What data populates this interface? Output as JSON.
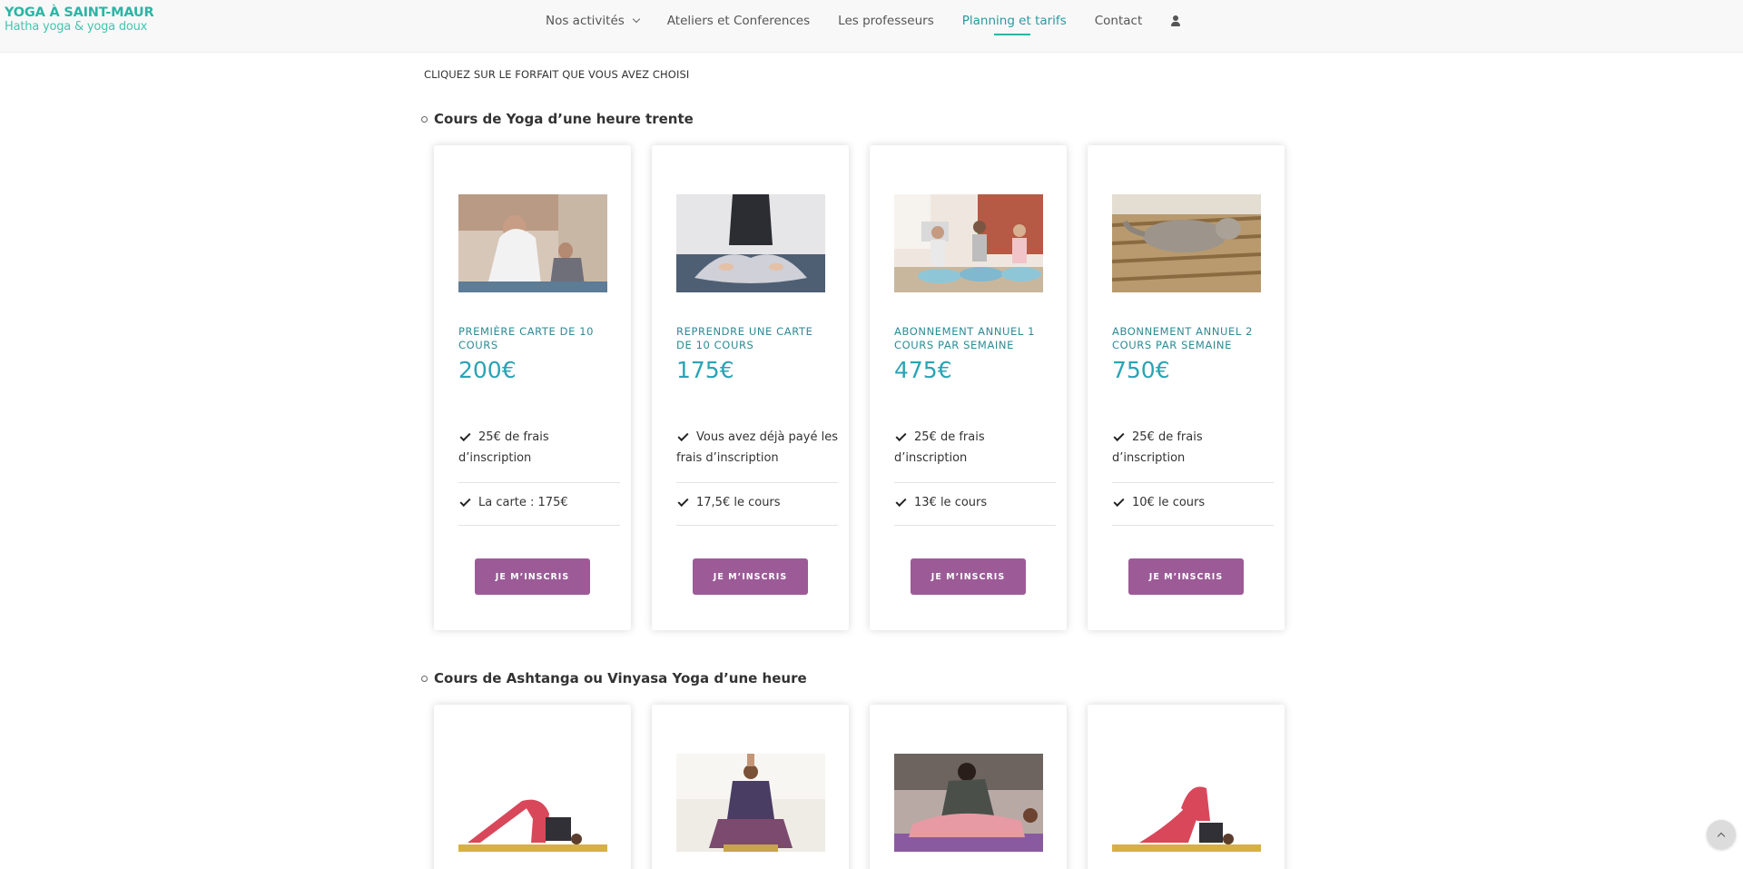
{
  "brand": {
    "title": "YOGA À SAINT-MAUR",
    "subtitle": "Hatha yoga & yoga doux"
  },
  "nav": {
    "items": [
      "Nos activités",
      "Ateliers et Conferences",
      "Les professeurs",
      "Planning et tarifs",
      "Contact"
    ],
    "active": "Planning et tarifs"
  },
  "intro": "CLIQUEZ SUR LE FORFAIT QUE VOUS AVEZ CHOISI",
  "sections": [
    {
      "title": "Cours de Yoga d’une heure trente",
      "cards": [
        {
          "title": "PREMIÈRE CARTE DE 10 COURS",
          "price": "200€",
          "features": [
            "25€ de frais d’inscription",
            "La carte : 175€"
          ],
          "button": "JE M’INSCRIS",
          "image": "yoga-class-photo"
        },
        {
          "title": "REPRENDRE UNE CARTE DE 10 COURS",
          "price": "175€",
          "features": [
            "Vous avez déjà payé les frais d’inscription",
            "17,5€ le cours"
          ],
          "button": "JE M’INSCRIS",
          "image": "lotus-pose-photo"
        },
        {
          "title": "ABONNEMENT ANNUEL 1 COURS PAR SEMAINE",
          "price": "475€",
          "features": [
            "25€ de frais d’inscription",
            "13€ le cours"
          ],
          "button": "JE M’INSCRIS",
          "image": "group-meditation-photo"
        },
        {
          "title": "ABONNEMENT ANNUEL 2 COURS PAR SEMAINE",
          "price": "750€",
          "features": [
            "25€ de frais d’inscription",
            "10€ le cours"
          ],
          "button": "JE M’INSCRIS",
          "image": "cat-stretching-photo"
        }
      ]
    },
    {
      "title": "Cours de Ashtanga ou Vinyasa Yoga d’une heure",
      "cards": [
        {
          "image": "plow-pose-photo"
        },
        {
          "image": "seated-twist-photo"
        },
        {
          "image": "assisted-stretch-photo"
        },
        {
          "image": "knee-to-ear-pose-photo"
        }
      ]
    }
  ],
  "colors": {
    "accent": "#2bb5a5",
    "price": "#2aa3b5",
    "button": "#9c5b97"
  }
}
